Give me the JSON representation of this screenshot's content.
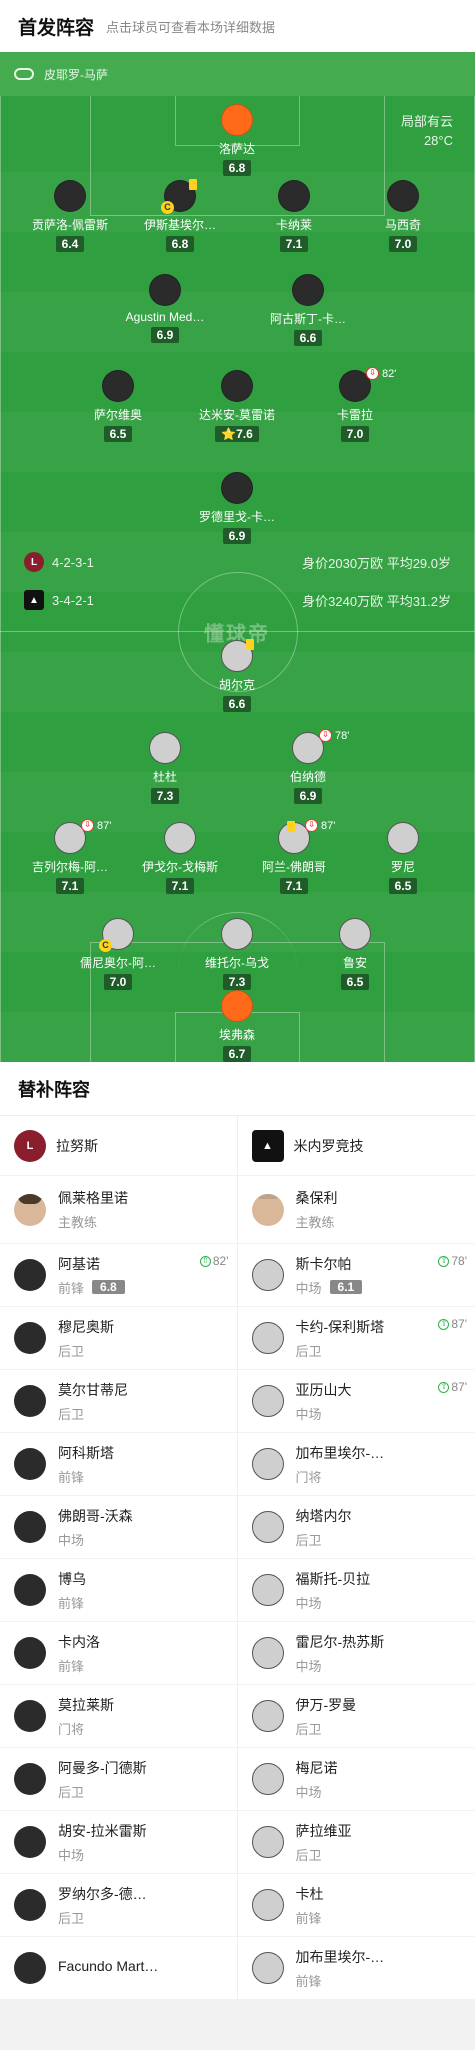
{
  "header": {
    "title": "首发阵容",
    "subtitle": "点击球员可查看本场详细数据"
  },
  "referee": "皮耶罗-马萨",
  "weather": {
    "condition": "局部有云",
    "temp": "28°C"
  },
  "watermark": "懂球帝",
  "home": {
    "name": "拉努斯",
    "formation": "4-2-3-1",
    "value_text": "身价2030万欧 平均29.0岁",
    "color": "#8b1e2c",
    "players": [
      {
        "name": "洛萨达",
        "rating": "6.8",
        "gk": true
      },
      {
        "name": "贡萨洛-佩雷斯",
        "rating": "6.4"
      },
      {
        "name": "伊斯基埃尔…",
        "rating": "6.8",
        "yellow": true,
        "captain": true
      },
      {
        "name": "卡纳莱",
        "rating": "7.1"
      },
      {
        "name": "马西奇",
        "rating": "7.0"
      },
      {
        "name": "Agustin Med…",
        "rating": "6.9"
      },
      {
        "name": "阿古斯丁-卡…",
        "rating": "6.6"
      },
      {
        "name": "萨尔维奥",
        "rating": "6.5"
      },
      {
        "name": "达米安-莫雷诺",
        "rating": "7.6",
        "star": true
      },
      {
        "name": "卡雷拉",
        "rating": "7.0",
        "sub_min": "82'"
      },
      {
        "name": "罗德里戈-卡…",
        "rating": "6.9"
      }
    ]
  },
  "away": {
    "name": "米内罗竞技",
    "formation": "3-4-2-1",
    "value_text": "身价3240万欧 平均31.2岁",
    "players": [
      {
        "name": "胡尔克",
        "rating": "6.6",
        "yellow": true
      },
      {
        "name": "杜杜",
        "rating": "7.3"
      },
      {
        "name": "伯纳德",
        "rating": "6.9",
        "sub_min": "78'"
      },
      {
        "name": "吉列尔梅-阿…",
        "rating": "7.1",
        "sub_min": "87'"
      },
      {
        "name": "伊戈尔-戈梅斯",
        "rating": "7.1"
      },
      {
        "name": "阿兰-佛朗哥",
        "rating": "7.1",
        "yellow": true,
        "sub_min": "87'"
      },
      {
        "name": "罗尼",
        "rating": "6.5"
      },
      {
        "name": "儒尼奥尔-阿…",
        "rating": "7.0",
        "captain": true
      },
      {
        "name": "维托尔-乌戈",
        "rating": "7.3"
      },
      {
        "name": "鲁安",
        "rating": "6.5"
      },
      {
        "name": "埃弗森",
        "rating": "6.7",
        "gk": true
      }
    ]
  },
  "subs_title": "替补阵容",
  "subs": {
    "home": {
      "team": "拉努斯",
      "coach": {
        "name": "佩莱格里诺",
        "role": "主教练"
      },
      "players": [
        {
          "name": "阿基诺",
          "pos": "前锋",
          "rating": "6.8",
          "in": "82'"
        },
        {
          "name": "穆尼奥斯",
          "pos": "后卫"
        },
        {
          "name": "莫尔甘蒂尼",
          "pos": "后卫"
        },
        {
          "name": "阿科斯塔",
          "pos": "前锋"
        },
        {
          "name": "佛朗哥-沃森",
          "pos": "中场"
        },
        {
          "name": "博乌",
          "pos": "前锋"
        },
        {
          "name": "卡内洛",
          "pos": "前锋"
        },
        {
          "name": "莫拉莱斯",
          "pos": "门将"
        },
        {
          "name": "阿曼多-门德斯",
          "pos": "后卫"
        },
        {
          "name": "胡安-拉米雷斯",
          "pos": "中场"
        },
        {
          "name": "罗纳尔多-德…",
          "pos": "后卫"
        },
        {
          "name": "Facundo Mart…",
          "pos": ""
        }
      ]
    },
    "away": {
      "team": "米内罗竞技",
      "coach": {
        "name": "桑保利",
        "role": "主教练"
      },
      "players": [
        {
          "name": "斯卡尔帕",
          "pos": "中场",
          "rating": "6.1",
          "in": "78'"
        },
        {
          "name": "卡约-保利斯塔",
          "pos": "后卫",
          "in": "87'"
        },
        {
          "name": "亚历山大",
          "pos": "中场",
          "in": "87'"
        },
        {
          "name": "加布里埃尔-…",
          "pos": "门将"
        },
        {
          "name": "纳塔内尔",
          "pos": "后卫"
        },
        {
          "name": "福斯托-贝拉",
          "pos": "中场"
        },
        {
          "name": "雷尼尔-热苏斯",
          "pos": "中场"
        },
        {
          "name": "伊万-罗曼",
          "pos": "后卫"
        },
        {
          "name": "梅尼诺",
          "pos": "中场"
        },
        {
          "name": "萨拉维亚",
          "pos": "后卫"
        },
        {
          "name": "卡杜",
          "pos": "前锋"
        },
        {
          "name": "加布里埃尔-…",
          "pos": "前锋"
        }
      ]
    }
  }
}
